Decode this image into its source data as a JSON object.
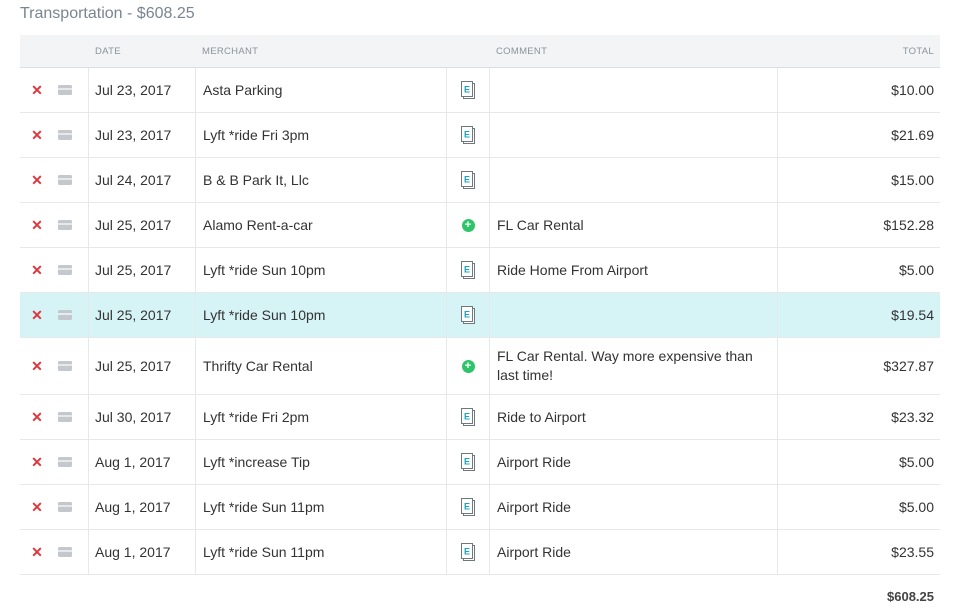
{
  "section": {
    "title": "Transportation - $608.25"
  },
  "columns": {
    "date": "DATE",
    "merchant": "MERCHANT",
    "comment": "COMMENT",
    "total": "TOTAL"
  },
  "rows": [
    {
      "date": "Jul 23, 2017",
      "merchant": "Asta Parking",
      "icon": "receipt-icon",
      "comment": "",
      "total": "$10.00"
    },
    {
      "date": "Jul 23, 2017",
      "merchant": "Lyft *ride Fri 3pm",
      "icon": "receipt-icon",
      "comment": "",
      "total": "$21.69"
    },
    {
      "date": "Jul 24, 2017",
      "merchant": "B & B Park It, Llc",
      "icon": "receipt-icon",
      "comment": "",
      "total": "$15.00"
    },
    {
      "date": "Jul 25, 2017",
      "merchant": "Alamo Rent-a-car",
      "icon": "add-icon",
      "comment": "FL Car Rental",
      "total": "$152.28"
    },
    {
      "date": "Jul 25, 2017",
      "merchant": "Lyft *ride Sun 10pm",
      "icon": "receipt-icon",
      "comment": "Ride Home From Airport",
      "total": "$5.00"
    },
    {
      "date": "Jul 25, 2017",
      "merchant": "Lyft *ride Sun 10pm",
      "icon": "receipt-icon",
      "comment": "",
      "total": "$19.54"
    },
    {
      "date": "Jul 25, 2017",
      "merchant": "Thrifty Car Rental",
      "icon": "add-icon",
      "comment": "FL Car Rental. Way more expensive than last time!",
      "total": "$327.87"
    },
    {
      "date": "Jul 30, 2017",
      "merchant": "Lyft *ride Fri 2pm",
      "icon": "receipt-icon",
      "comment": "Ride to Airport",
      "total": "$23.32"
    },
    {
      "date": "Aug 1, 2017",
      "merchant": "Lyft *increase Tip",
      "icon": "receipt-icon",
      "comment": "Airport Ride",
      "total": "$5.00"
    },
    {
      "date": "Aug 1, 2017",
      "merchant": "Lyft *ride Sun 11pm",
      "icon": "receipt-icon",
      "comment": "Airport Ride",
      "total": "$5.00"
    },
    {
      "date": "Aug 1, 2017",
      "merchant": "Lyft *ride Sun 11pm",
      "icon": "receipt-icon",
      "comment": "Airport Ride",
      "total": "$23.55"
    }
  ],
  "glyphs": {
    "delete": "✕",
    "add": "+",
    "receipt_letter": "E"
  },
  "footer": {
    "total": "$608.25"
  },
  "colors": {
    "delete": "#e0353b",
    "add": "#2fc46a",
    "receipt": "#1aa3c0",
    "selected_row": "#d6f3f6"
  }
}
